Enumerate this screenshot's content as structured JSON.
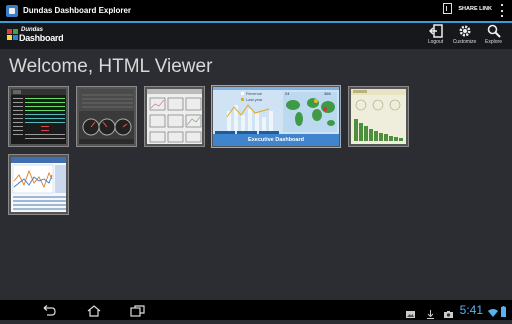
{
  "app": {
    "title": "Dundas Dashboard Explorer",
    "share_label": "SHARE LINK"
  },
  "logo": {
    "word1": "Dundas",
    "word2": "Dashboard"
  },
  "actions": [
    {
      "label": "Logout",
      "icon": "logout-icon"
    },
    {
      "label": "Customize",
      "icon": "gear-icon"
    },
    {
      "label": "Explore",
      "icon": "search-icon"
    }
  ],
  "welcome": "Welcome, HTML Viewer",
  "featured": {
    "caption": "Executive Dashboard",
    "legend": [
      "Revenue",
      "Last year"
    ],
    "kpi_left": "24",
    "kpi_right": "366"
  },
  "status": {
    "time": "5:41"
  },
  "colors": {
    "accent": "#3a9bd6",
    "clock": "#56b3f0",
    "featured_bg": "#4f92d4"
  }
}
